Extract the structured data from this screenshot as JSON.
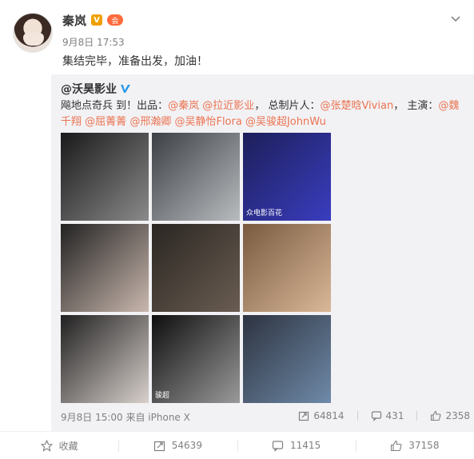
{
  "post": {
    "author_name": "秦岚",
    "verified_badge": "V",
    "vip_badge": "会",
    "meta": "9月8日 17:53",
    "text": "集结完毕，准备出发，加油！"
  },
  "repost": {
    "original_author": "@沃昊影业",
    "text_parts": [
      {
        "t": "飚地点奇兵 到！出品：",
        "m": false
      },
      {
        "t": "@秦岚",
        "m": true
      },
      {
        "t": " ",
        "m": false
      },
      {
        "t": "@拉近影业",
        "m": true
      },
      {
        "t": "， 总制片人：",
        "m": false
      },
      {
        "t": "@张楚晗Vivian",
        "m": true
      },
      {
        "t": "， 主演：",
        "m": false
      },
      {
        "t": "@魏千翔",
        "m": true
      },
      {
        "t": " ",
        "m": false
      },
      {
        "t": "@屈菁菁",
        "m": true
      },
      {
        "t": " ",
        "m": false
      },
      {
        "t": "@邢瀚卿",
        "m": true
      },
      {
        "t": " ",
        "m": false
      },
      {
        "t": "@吴静怡Flora",
        "m": true
      },
      {
        "t": " ",
        "m": false
      },
      {
        "t": "@吴骏超JohnWu",
        "m": true
      }
    ],
    "images": [
      {
        "alt": "actor-portrait-1",
        "colors": [
          "#1a1a1a",
          "#8a8a8a"
        ],
        "caption": ""
      },
      {
        "alt": "actor-portrait-2",
        "colors": [
          "#3c3f44",
          "#b9bcbf"
        ],
        "caption": ""
      },
      {
        "alt": "film-festival-poster",
        "colors": [
          "#1d1f5a",
          "#3a3dbf"
        ],
        "caption": "众电影百花"
      },
      {
        "alt": "actress-portrait-1",
        "colors": [
          "#222",
          "#c9b7ad"
        ],
        "caption": ""
      },
      {
        "alt": "actor-portrait-3",
        "colors": [
          "#2a2622",
          "#6a5d52"
        ],
        "caption": ""
      },
      {
        "alt": "actress-portrait-2",
        "colors": [
          "#7a5a40",
          "#d9b898"
        ],
        "caption": ""
      },
      {
        "alt": "actress-portrait-3",
        "colors": [
          "#202020",
          "#d8d0cc"
        ],
        "caption": ""
      },
      {
        "alt": "actor-portrait-4",
        "colors": [
          "#0e0e0e",
          "#9a9a9a"
        ],
        "caption": "骏超"
      },
      {
        "alt": "actor-portrait-5",
        "colors": [
          "#2d3340",
          "#6f8aa8"
        ],
        "caption": ""
      }
    ],
    "time_source": "9月8日 15:00 来自 iPhone X",
    "reposts": "64814",
    "comments": "431",
    "likes": "2358"
  },
  "actions": {
    "favorite_label": "收藏",
    "repost_count": "54639",
    "comment_count": "11415",
    "like_count": "37158"
  },
  "colors": {
    "mention": "#eb7350",
    "repost_bg": "#f2f2f5",
    "verified_blue": "#2a9ae6"
  }
}
